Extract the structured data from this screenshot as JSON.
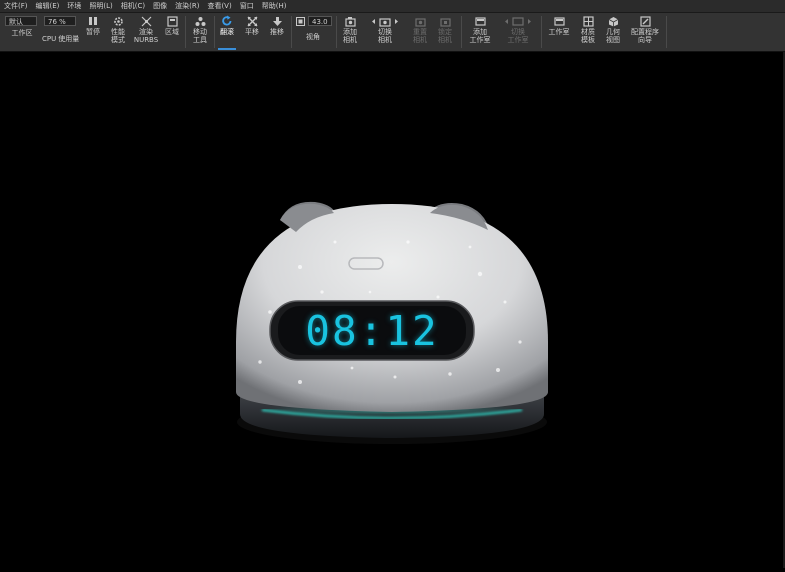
{
  "menu": [
    "文件(F)",
    "编辑(E)",
    "环境",
    "照明(L)",
    "相机(C)",
    "图像",
    "渲染(R)",
    "查看(V)",
    "窗口",
    "帮助(H)"
  ],
  "toolbar": {
    "workspace_value": "默认",
    "workspace_label": "工作区",
    "cpu_value": "76 %",
    "cpu_prefix": "CPU",
    "cpu_label": "使用量",
    "pause": "暂停",
    "perf": "性能\n模式",
    "render_nurbs": "渲染\nNURBS",
    "region": "区域",
    "move_tool": "移动\n工具",
    "tumble": "翻滚",
    "pan": "平移",
    "dolly": "推移",
    "fov_value": "43.0",
    "fov_label": "视角",
    "add_camera": "添加\n相机",
    "switch_camera": "切换\n相机",
    "reset_camera": "重置\n相机",
    "lock_camera": "锁定\n相机",
    "add_studio": "添加\n工作室",
    "switch_studio": "切换\n工作室",
    "studio": "工作室",
    "material_templates": "材质\n模板",
    "geometry_view": "几何\n视图",
    "config_wizard": "配置程序\n向导"
  },
  "scene": {
    "clock_time": "08:12",
    "device_color": "#d9dadc",
    "display_color": "#19c3e0",
    "ring_color": "#2fd9c9"
  }
}
